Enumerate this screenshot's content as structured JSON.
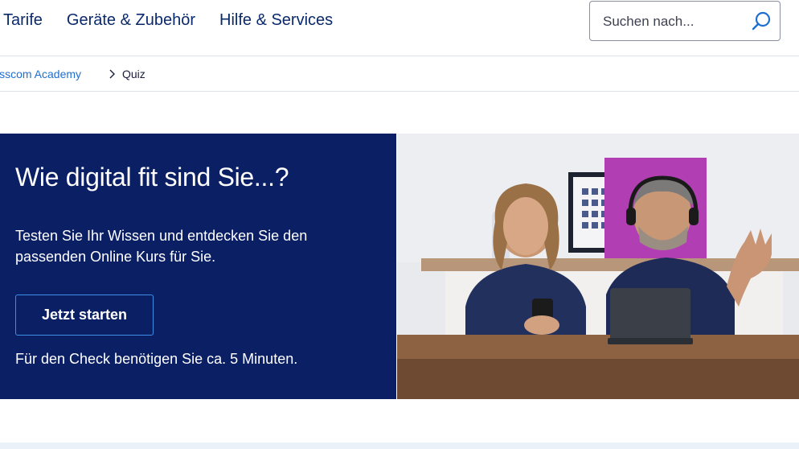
{
  "nav": {
    "items": [
      {
        "label": "Tarife"
      },
      {
        "label": "Geräte & Zubehör"
      },
      {
        "label": "Hilfe & Services"
      }
    ],
    "search": {
      "placeholder": "Suchen nach..."
    }
  },
  "breadcrumb": {
    "parent": "isscom Academy",
    "current": "Quiz"
  },
  "hero": {
    "title": "Wie digital fit sind Sie...?",
    "description": "Testen Sie Ihr Wissen und entdecken Sie den passenden Online Kurs für Sie.",
    "button_label": "Jetzt starten",
    "note": "Für den Check benötigen Sie ca. 5 Minuten."
  },
  "colors": {
    "brand_navy": "#0b1f64",
    "link_blue": "#1f6fd1",
    "nav_text": "#0a2a6b",
    "button_border": "#3d8fe6"
  },
  "icons": {
    "search": "search-icon",
    "breadcrumb_separator": "chevron-right-icon"
  }
}
